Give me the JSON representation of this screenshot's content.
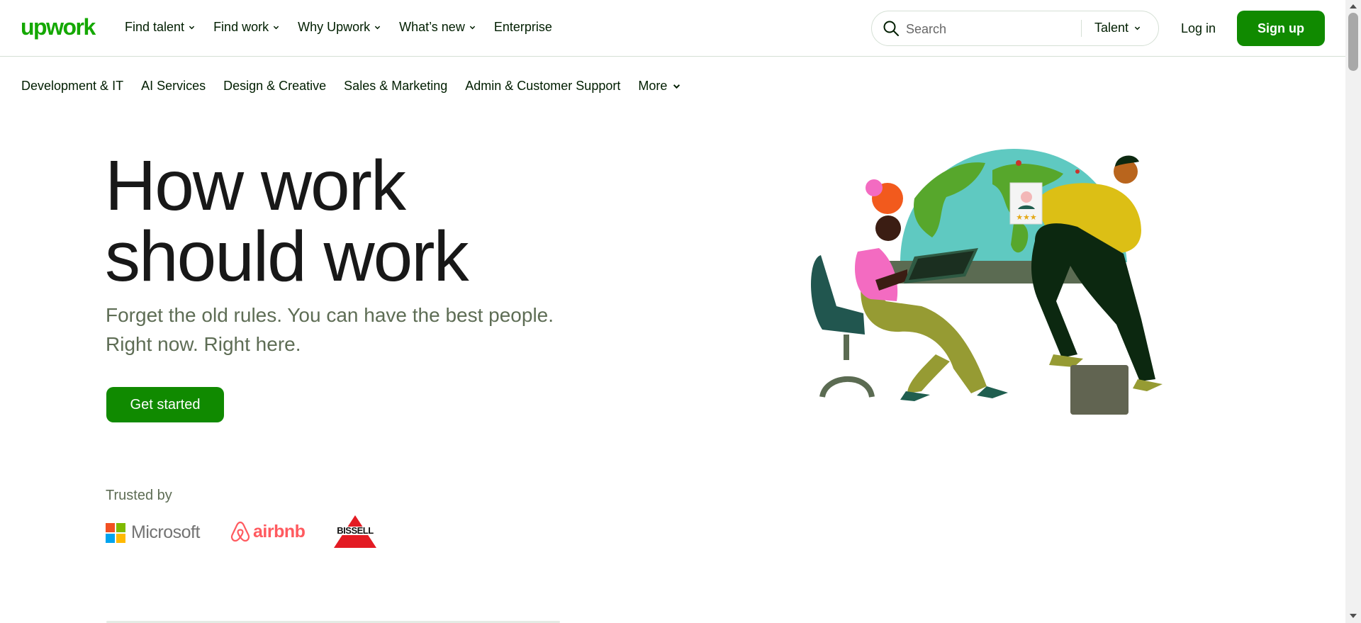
{
  "header": {
    "logo_text": "upwork",
    "nav": [
      {
        "label": "Find talent",
        "has_dropdown": true
      },
      {
        "label": "Find work",
        "has_dropdown": true
      },
      {
        "label": "Why Upwork",
        "has_dropdown": true
      },
      {
        "label": "What’s new",
        "has_dropdown": true
      },
      {
        "label": "Enterprise",
        "has_dropdown": false
      }
    ],
    "search": {
      "placeholder": "Search",
      "scope": "Talent"
    },
    "login_label": "Log in",
    "signup_label": "Sign up"
  },
  "categories": [
    {
      "label": "Development & IT"
    },
    {
      "label": "AI Services"
    },
    {
      "label": "Design & Creative"
    },
    {
      "label": "Sales & Marketing"
    },
    {
      "label": "Admin & Customer Support"
    },
    {
      "label": "More",
      "has_dropdown": true
    }
  ],
  "hero": {
    "title_lines": [
      "How work",
      "should work"
    ],
    "subtitle_lines": [
      "Forget the old rules. You can have the best people.",
      "Right now. Right here."
    ],
    "cta_label": "Get started"
  },
  "trusted": {
    "label": "Trusted by",
    "logos": [
      {
        "name": "Microsoft",
        "text": "Microsoft"
      },
      {
        "name": "Airbnb",
        "text": "airbnb"
      },
      {
        "name": "Bissell",
        "text": "BISSELL"
      }
    ]
  },
  "colors": {
    "brand_green": "#14a800",
    "button_green": "#108a00",
    "text_dark": "#001e00",
    "text_muted": "#5e6d55"
  },
  "icons": [
    "search-icon",
    "chevron-down-icon"
  ]
}
